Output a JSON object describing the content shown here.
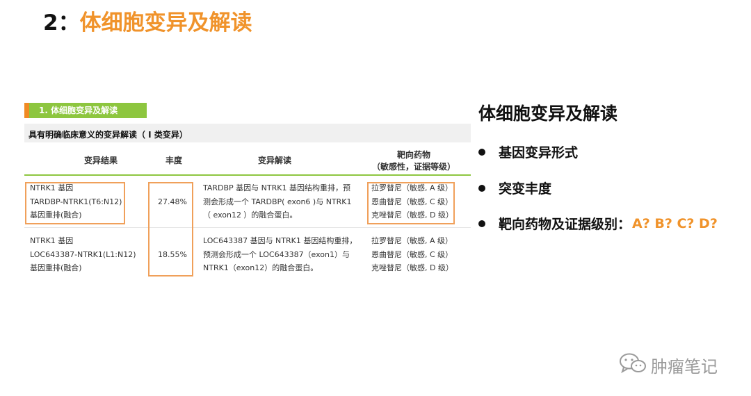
{
  "slide": {
    "number": "2：",
    "title": "体细胞变异及解读"
  },
  "report": {
    "section_header": "1. 体细胞变异及解读",
    "subheading": "具有明确临床意义的变异解读（ Ⅰ 类变异）",
    "columns": {
      "result": "变异结果",
      "abundance": "丰度",
      "interpretation": "变异解读",
      "drug_line1": "靶向药物",
      "drug_line2": "（敏感性，证据等级）"
    },
    "rows": [
      {
        "result": [
          "NTRK1 基因",
          "TARDBP-NTRK1(T6:N12)",
          "基因重排(融合)"
        ],
        "abundance": "27.48%",
        "interpretation": [
          "TARDBP 基因与 NTRK1 基因结构重排，预",
          "测会形成一个 TARDBP( exon6 )与 NTRK1",
          "（ exon12 ）的融合蛋白。"
        ],
        "drugs": [
          "拉罗替尼（敏感, A 级）",
          "恩曲替尼（敏感, C 级）",
          "克唑替尼（敏感, D 级）"
        ]
      },
      {
        "result": [
          "NTRK1 基因",
          "LOC643387-NTRK1(L1:N12)",
          "基因重排(融合)"
        ],
        "abundance": "18.55%",
        "interpretation": [
          "LOC643387 基因与 NTRK1 基因结构重排，",
          "预测会形成一个 LOC643387（exon1）与",
          "NTRK1（exon12）的融合蛋白。"
        ],
        "drugs": [
          "拉罗替尼（敏感, A 级）",
          "恩曲替尼（敏感, C 级）",
          "克唑替尼（敏感, D 级）"
        ]
      }
    ]
  },
  "panel": {
    "title": "体细胞变异及解读",
    "bullets": [
      {
        "label": "基因变异形式",
        "extra": ""
      },
      {
        "label": "突变丰度",
        "extra": ""
      },
      {
        "label": "靶向药物及证据级别：",
        "extra": "A? B? C? D?"
      }
    ]
  },
  "watermark": {
    "text": "肿瘤笔记",
    "icon": "wechat-icon"
  },
  "colors": {
    "accent_orange": "#f0932b",
    "header_green": "#8dc63f",
    "highlight_box": "#f0a05a"
  }
}
